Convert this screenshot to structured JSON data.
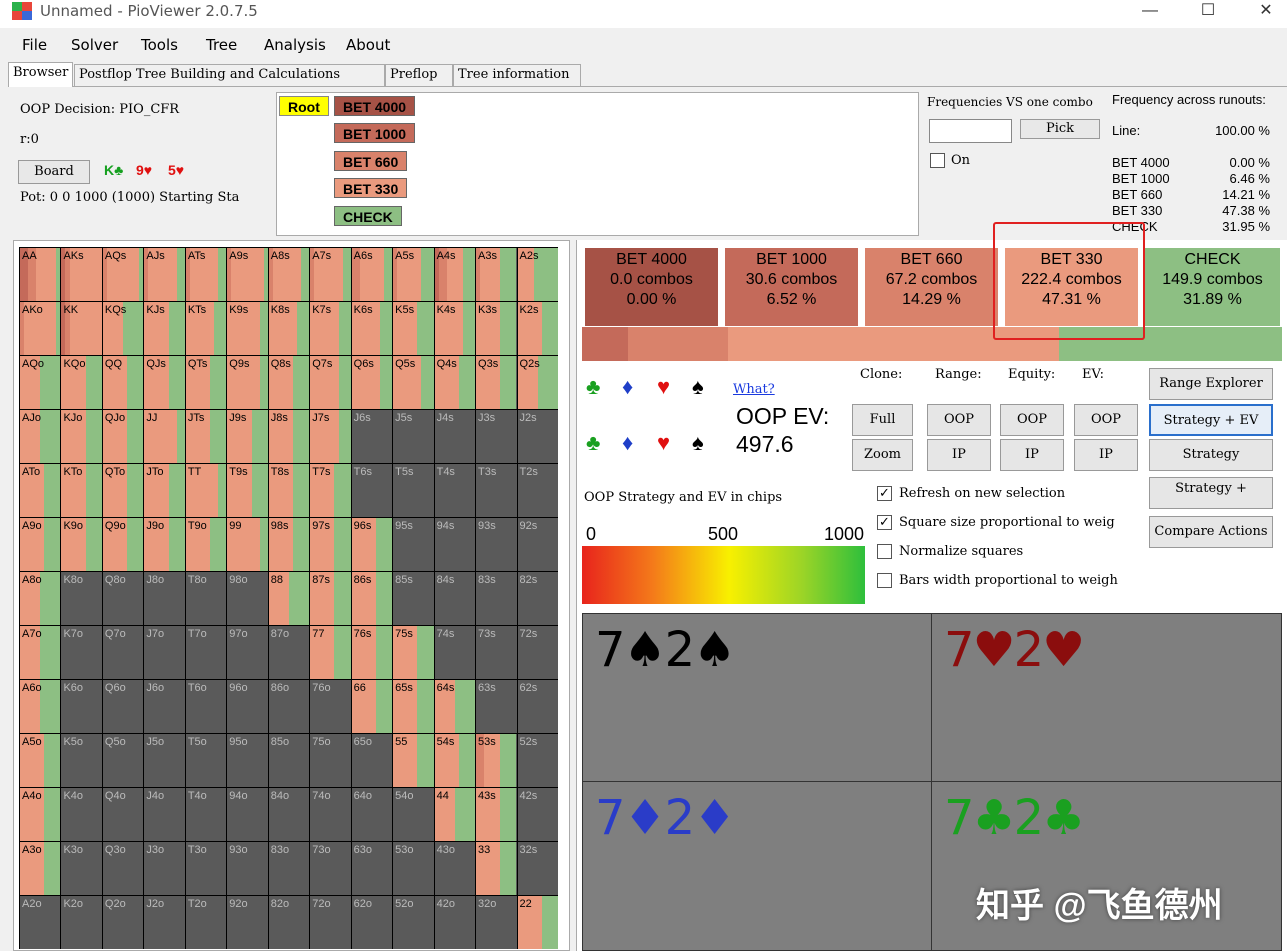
{
  "window": {
    "title": "Unnamed  - PioViewer 2.0.7.5",
    "min": "—",
    "max": "☐",
    "close": "✕"
  },
  "menu": [
    "File",
    "Solver",
    "Tools",
    "Tree",
    "Analysis",
    "About"
  ],
  "tabs": [
    "Browser",
    "Postflop Tree Building and Calculations",
    "Preflop",
    "Tree information"
  ],
  "info": {
    "decision": "OOP Decision:  PIO_CFR",
    "r": "r:0",
    "board_btn": "Board",
    "board": [
      {
        "text": "K♣",
        "color": "#16a020"
      },
      {
        "text": "9♥",
        "color": "#e01010"
      },
      {
        "text": "5♥",
        "color": "#e01010"
      }
    ],
    "pot": "Pot: 0 0 1000 (1000) Starting Sta"
  },
  "tree": {
    "root": "Root",
    "nodes": [
      {
        "label": "BET 4000",
        "color": "#a65246"
      },
      {
        "label": "BET 1000",
        "color": "#c46a5a"
      },
      {
        "label": "BET 660",
        "color": "#d9826b"
      },
      {
        "label": "BET 330",
        "color": "#ea9a7e"
      },
      {
        "label": "CHECK",
        "color": "#8dbf83"
      }
    ]
  },
  "frequencies": {
    "title": "Frequencies VS one combo",
    "pick": "Pick",
    "on": "On"
  },
  "across": {
    "title": "Frequency across runouts:",
    "rows": [
      {
        "label": "Line:",
        "value": "100.00 %"
      },
      {
        "label": "BET 4000",
        "value": "0.00 %"
      },
      {
        "label": "BET 1000",
        "value": "6.46 %"
      },
      {
        "label": "BET 660",
        "value": "14.21 %"
      },
      {
        "label": "BET 330",
        "value": "47.38 %"
      },
      {
        "label": "CHECK",
        "value": "31.95 %"
      }
    ]
  },
  "actions": [
    {
      "name": "BET 4000",
      "combos": "0.0 combos",
      "pct": "0.00 %",
      "color": "#a65246",
      "freq": 0.0
    },
    {
      "name": "BET 1000",
      "combos": "30.6 combos",
      "pct": "6.52 %",
      "color": "#c46a5a",
      "freq": 0.0652
    },
    {
      "name": "BET 660",
      "combos": "67.2 combos",
      "pct": "14.29 %",
      "color": "#d9826b",
      "freq": 0.1429
    },
    {
      "name": "BET 330",
      "combos": "222.4 combos",
      "pct": "47.31 %",
      "color": "#ea9a7e",
      "freq": 0.4731
    },
    {
      "name": "CHECK",
      "combos": "149.9 combos",
      "pct": "31.89 %",
      "color": "#8dbf83",
      "freq": 0.3189
    }
  ],
  "controls": {
    "what": "What?",
    "oop_ev_label": "OOP EV:",
    "oop_ev_value": "497.6",
    "clone": "Clone:",
    "range": "Range:",
    "equity": "Equity:",
    "ev": "EV:",
    "full": "Full",
    "zoom": "Zoom",
    "oop": "OOP",
    "ip": "IP",
    "range_explorer": "Range Explorer",
    "strategy_ev": "Strategy + EV",
    "strategy": "Strategy",
    "strategy_plus": "Strategy +",
    "compare": "Compare Actions",
    "strategy_caption": "OOP Strategy and EV in chips",
    "scale": [
      "0",
      "500",
      "1000"
    ],
    "options": [
      {
        "label": "Refresh on new selection",
        "checked": true
      },
      {
        "label": "Square size proportional to weig",
        "checked": true
      },
      {
        "label": "Normalize squares",
        "checked": false
      },
      {
        "label": "Bars width proportional to weigh",
        "checked": false
      }
    ]
  },
  "combos": [
    {
      "rank": "7",
      "suit": "♠",
      "rank2": "2",
      "suit2": "♠",
      "color": "#000000"
    },
    {
      "rank": "7",
      "suit": "♥",
      "rank2": "2",
      "suit2": "♥",
      "color": "#8b0d0d"
    },
    {
      "rank": "7",
      "suit": "♦",
      "rank2": "2",
      "suit2": "♦",
      "color": "#2a3cc8"
    },
    {
      "rank": "7",
      "suit": "♣",
      "rank2": "2",
      "suit2": "♣",
      "color": "#1aa020"
    }
  ],
  "watermark": "知乎 @飞鱼德州",
  "grid": {
    "ranks": [
      "A",
      "K",
      "Q",
      "J",
      "T",
      "9",
      "8",
      "7",
      "6",
      "5",
      "4",
      "3",
      "2"
    ],
    "colors": {
      "b1000": "#c46a5a",
      "b660": "#d9826b",
      "b330": "#ea9a7e",
      "check": "#8dbf83",
      "none": "#5a5a5a"
    },
    "rows": [
      [
        "AA|0.2,0.2,0.5,0.1",
        "AKs|0.1,0.1,0.8,0",
        "AQs|0,0.1,0.8,0.1",
        "AJs|0,0.1,0.7,0.2",
        "ATs|0,0.1,0.7,0.2",
        "A9s|0,0.1,0.8,0.1",
        "A8s|0,0.1,0.7,0.2",
        "A7s|0,0.1,0.7,0.2",
        "A6s|0,0.2,0.6,0.2",
        "A5s|0,0.1,0.6,0.3",
        "A4s|0.1,0.2,0.4,0.3",
        "A3s|0,0.1,0.5,0.4",
        "A2s|0,0,0.4,0.6"
      ],
      [
        "AKo|0,0.1,0.8,0.1",
        "KK|0.1,0.1,0.8,0",
        "KQs|0,0,0.5,0.5",
        "KJs|0,0,0.6,0.4",
        "KTs|0,0,0.7,0.3",
        "K9s|0,0,0.8,0.2",
        "K8s|0,0,0.7,0.3",
        "K7s|0,0,0.7,0.3",
        "K6s|0,0,0.7,0.3",
        "K5s|0,0,0.6,0.4",
        "K4s|0,0,0.7,0.3",
        "K3s|0,0,0.6,0.4",
        "K2s|0,0,0.6,0.4"
      ],
      [
        "AQo|0,0,0.5,0.5",
        "KQo|0,0,0.6,0.4",
        "QQ|0,0,0.6,0.4",
        "QJs|0,0,0.6,0.4",
        "QTs|0,0,0.6,0.4",
        "Q9s|0,0,0.8,0.2",
        "Q8s|0,0,0.6,0.4",
        "Q7s|0,0,0.7,0.3",
        "Q6s|0,0,0.7,0.3",
        "Q5s|0,0,0.7,0.3",
        "Q4s|0,0,0.6,0.4",
        "Q3s|0,0,0.6,0.4",
        "Q2s|0,0,0.5,0.5"
      ],
      [
        "AJo|0,0,0.5,0.5",
        "KJo|0,0,0.6,0.4",
        "QJo|0,0,0.6,0.4",
        "JJ|0,0,0.8,0.2",
        "JTs|0,0,0.6,0.4",
        "J9s|0,0,0.6,0.4",
        "J8s|0,0,0.6,0.4",
        "J7s|0,0,0.7,0.3",
        "J6s|0,0,0,0",
        "J5s|0,0,0,0",
        "J4s|0,0,0,0",
        "J3s|0,0,0,0",
        "J2s|0,0,0,0"
      ],
      [
        "ATo|0,0,0.6,0.4",
        "KTo|0,0,0.6,0.4",
        "QTo|0,0,0.6,0.4",
        "JTo|0,0,0.6,0.4",
        "TT|0,0,0.8,0.2",
        "T9s|0,0,0.6,0.4",
        "T8s|0,0,0.6,0.4",
        "T7s|0,0,0.6,0.4",
        "T6s|0,0,0,0",
        "T5s|0,0,0,0",
        "T4s|0,0,0,0",
        "T3s|0,0,0,0",
        "T2s|0,0,0,0"
      ],
      [
        "A9o|0,0,0.6,0.4",
        "K9o|0,0,0.6,0.4",
        "Q9o|0,0,0.6,0.4",
        "J9o|0,0,0.6,0.4",
        "T9o|0,0,0.6,0.4",
        "99|0,0,0.8,0.2",
        "98s|0,0,0.6,0.4",
        "97s|0,0,0.6,0.4",
        "96s|0,0,0.6,0.4",
        "95s|0,0,0,0",
        "94s|0,0,0,0",
        "93s|0,0,0,0",
        "92s|0,0,0,0"
      ],
      [
        "A8o|0,0,0.5,0.5",
        "K8o|0,0,0,0",
        "Q8o|0,0,0,0",
        "J8o|0,0,0,0",
        "T8o|0,0,0,0",
        "98o|0,0,0,0",
        "88|0,0,0.5,0.5",
        "87s|0,0,0.6,0.4",
        "86s|0,0,0.6,0.4",
        "85s|0,0,0,0",
        "84s|0,0,0,0",
        "83s|0,0,0,0",
        "82s|0,0,0,0"
      ],
      [
        "A7o|0,0,0.5,0.5",
        "K7o|0,0,0,0",
        "Q7o|0,0,0,0",
        "J7o|0,0,0,0",
        "T7o|0,0,0,0",
        "97o|0,0,0,0",
        "87o|0,0,0,0",
        "77|0,0,0.6,0.4",
        "76s|0,0,0.6,0.4",
        "75s|0,0,0.6,0.4",
        "74s|0,0,0,0",
        "73s|0,0,0,0",
        "72s|0,0,0,0"
      ],
      [
        "A6o|0,0,0.5,0.5",
        "K6o|0,0,0,0",
        "Q6o|0,0,0,0",
        "J6o|0,0,0,0",
        "T6o|0,0,0,0",
        "96o|0,0,0,0",
        "86o|0,0,0,0",
        "76o|0,0,0,0",
        "66|0,0,0.6,0.4",
        "65s|0,0,0.6,0.4",
        "64s|0,0,0.5,0.5",
        "63s|0,0,0,0",
        "62s|0,0,0,0"
      ],
      [
        "A5o|0,0,0.6,0.4",
        "K5o|0,0,0,0",
        "Q5o|0,0,0,0",
        "J5o|0,0,0,0",
        "T5o|0,0,0,0",
        "95o|0,0,0,0",
        "85o|0,0,0,0",
        "75o|0,0,0,0",
        "65o|0,0,0,0",
        "55|0,0,0.6,0.4",
        "54s|0,0,0.6,0.4",
        "53s|0,0.2,0.4,0.4",
        "52s|0,0,0,0"
      ],
      [
        "A4o|0,0,0.6,0.4",
        "K4o|0,0,0,0",
        "Q4o|0,0,0,0",
        "J4o|0,0,0,0",
        "T4o|0,0,0,0",
        "94o|0,0,0,0",
        "84o|0,0,0,0",
        "74o|0,0,0,0",
        "64o|0,0,0,0",
        "54o|0,0,0,0",
        "44|0,0,0.5,0.5",
        "43s|0,0,0.6,0.4",
        "42s|0,0,0,0"
      ],
      [
        "A3o|0,0,0.6,0.4",
        "K3o|0,0,0,0",
        "Q3o|0,0,0,0",
        "J3o|0,0,0,0",
        "T3o|0,0,0,0",
        "93o|0,0,0,0",
        "83o|0,0,0,0",
        "73o|0,0,0,0",
        "63o|0,0,0,0",
        "53o|0,0,0,0",
        "43o|0,0,0,0",
        "33|0,0,0.6,0.4",
        "32s|0,0,0,0"
      ],
      [
        "A2o|0,0,0,0",
        "K2o|0,0,0,0",
        "Q2o|0,0,0,0",
        "J2o|0,0,0,0",
        "T2o|0,0,0,0",
        "92o|0,0,0,0",
        "82o|0,0,0,0",
        "72o|0,0,0,0",
        "62o|0,0,0,0",
        "52o|0,0,0,0",
        "42o|0,0,0,0",
        "32o|0,0,0,0",
        "22|0,0,0.6,0.4"
      ]
    ]
  }
}
